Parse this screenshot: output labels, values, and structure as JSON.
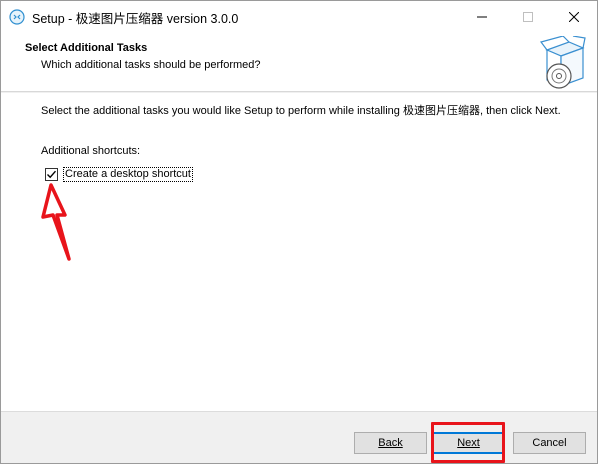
{
  "window": {
    "title": "Setup - 极速图片压缩器 version 3.0.0",
    "buttons": {
      "minimize": "minimize",
      "maximize": "maximize",
      "close": "close"
    }
  },
  "header": {
    "title": "Select Additional Tasks",
    "subtitle": "Which additional tasks should be performed?",
    "image_icon": "installer-box-cd-icon"
  },
  "content": {
    "description": "Select the additional tasks you would like Setup to perform while installing 极速图片压缩器, then click Next.",
    "group_label": "Additional shortcuts:",
    "tasks": [
      {
        "label": "Create a desktop shortcut",
        "checked": true
      }
    ]
  },
  "footer": {
    "back_label": "Back",
    "next_label": "Next",
    "cancel_label": "Cancel"
  },
  "annotations": {
    "color": "#e8141b",
    "arrow_target": "desktop-shortcut-checkbox",
    "box_target": "next-button"
  }
}
